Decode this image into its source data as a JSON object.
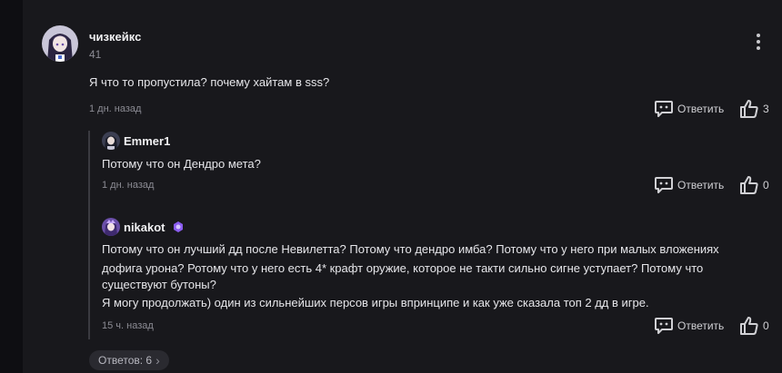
{
  "comment": {
    "username": "чизкейкс",
    "level": "41",
    "text": "Я что то пропустила? почему хайтам в sss?",
    "time": "1 дн. назад",
    "reply_label": "Ответить",
    "likes": "3"
  },
  "replies": [
    {
      "username": "Emmer1",
      "text": "Потому что он Дендро мета?",
      "time": "1 дн. назад",
      "reply_label": "Ответить",
      "likes": "0"
    },
    {
      "username": "nikakot",
      "text_lines": [
        "Потому что он лучший дд после Невилетта? Потому что дендро имба? Потому что у него при малых вложениях",
        "дофига урона? Ротому что у него есть 4* крафт оружие, которое не такти сильно сигне уступает? Потому что",
        "существуют бутоны?",
        "Я могу продолжать) один из сильнейших персов игры впринципе и как уже сказала топ 2 дд в игре."
      ],
      "time": "15 ч. назад",
      "reply_label": "Ответить",
      "likes": "0"
    }
  ],
  "replies_toggle": {
    "label": "Ответов: 6",
    "chevron": "›"
  },
  "icons": {
    "reply": "speech-bubble-icon",
    "like": "thumbs-up-icon",
    "menu": "kebab-menu-icon",
    "badge": "purple-emblem-icon"
  },
  "colors": {
    "background": "#18181c",
    "accent_purple": "#8a5cf0"
  }
}
